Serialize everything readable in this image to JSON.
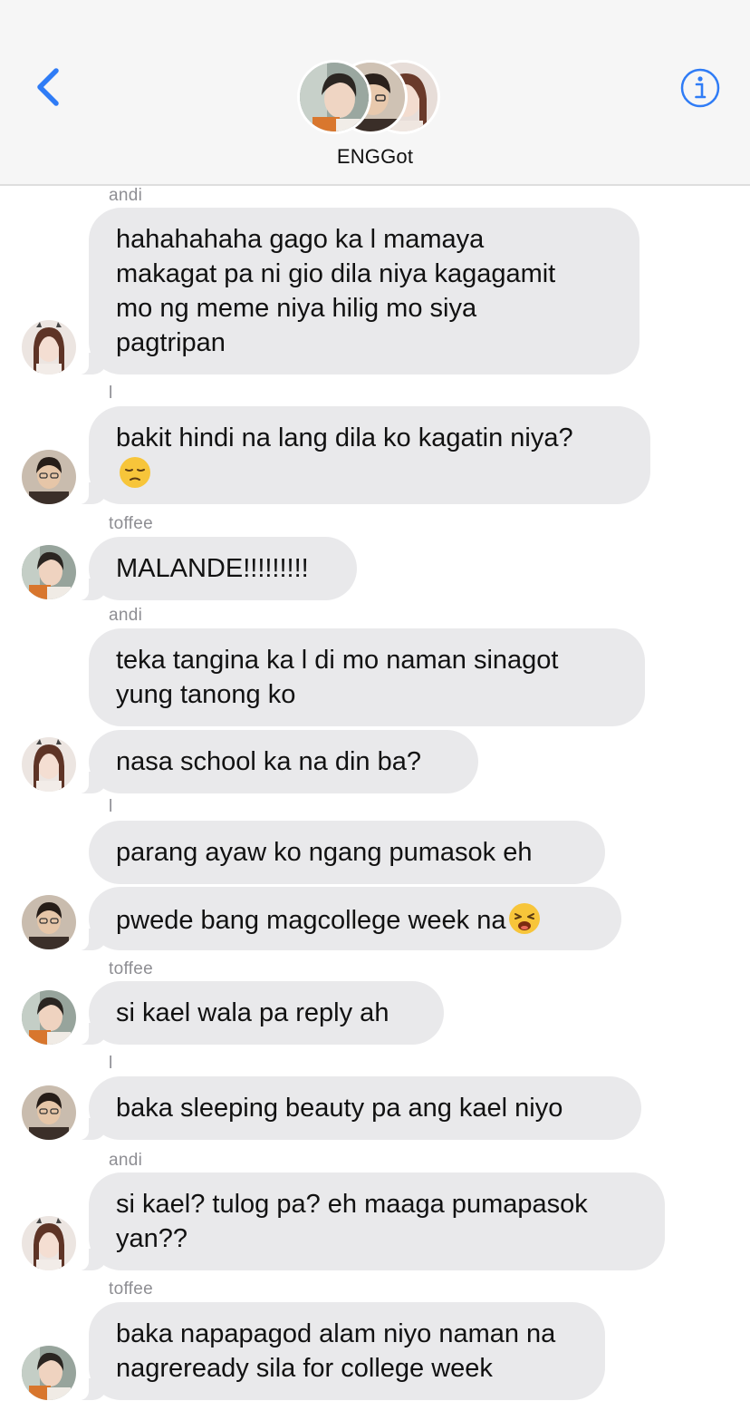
{
  "header": {
    "back_icon": "chevron-left-icon",
    "info_icon": "info-circle-icon",
    "group_name": "ENGGot",
    "accent_color": "#2f7cf6"
  },
  "messages": [
    {
      "sender": "andi",
      "lines": [
        "hahahahaha gago ka l mamaya",
        "makagat pa ni gio dila niya kagagamit",
        "mo ng meme niya hilig mo siya",
        "pagtripan"
      ],
      "avatar": "andi"
    },
    {
      "sender": "l",
      "lines": [
        "bakit hindi na lang dila ko kagatin niya?"
      ],
      "emoji": "pensive-face-emoji",
      "avatar": "l"
    },
    {
      "sender": "toffee",
      "lines": [
        "MALANDE!!!!!!!!!"
      ],
      "avatar": "toffee"
    },
    {
      "sender": "andi",
      "lines": [
        "teka tangina ka l di mo naman sinagot",
        "yung tanong ko"
      ]
    },
    {
      "lines": [
        "nasa school ka na din ba?"
      ],
      "avatar": "andi"
    },
    {
      "sender": "l",
      "lines": [
        "parang ayaw ko ngang pumasok eh"
      ]
    },
    {
      "lines": [
        "pwede bang magcollege week na"
      ],
      "emoji": "weary-face-emoji",
      "avatar": "l"
    },
    {
      "sender": "toffee",
      "lines": [
        "si kael wala pa reply ah"
      ],
      "avatar": "toffee"
    },
    {
      "sender": "l",
      "lines": [
        "baka sleeping beauty pa ang kael niyo"
      ],
      "avatar": "l"
    },
    {
      "sender": "andi",
      "lines": [
        "si kael? tulog pa? eh maaga pumapasok",
        "yan??"
      ],
      "avatar": "andi"
    },
    {
      "sender": "toffee",
      "lines": [
        "baka napapagod alam niyo naman na",
        "nagreready sila for college week"
      ],
      "avatar": "toffee"
    }
  ],
  "colors": {
    "bubble": "#e9e9eb",
    "sender_label": "#8e8e93",
    "header_bg": "#f6f6f6"
  }
}
